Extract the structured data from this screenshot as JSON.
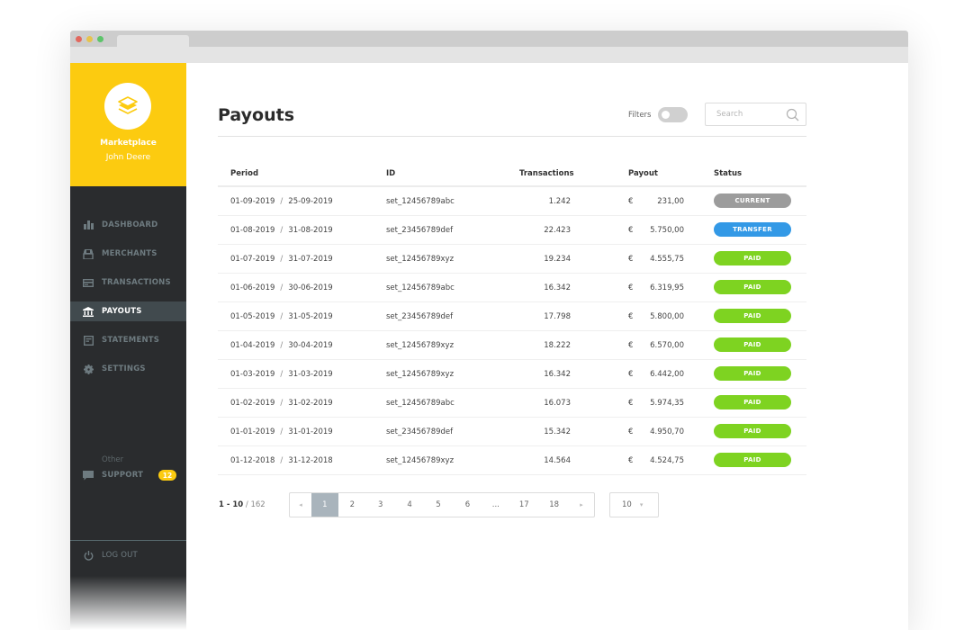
{
  "sidebar": {
    "brand": {
      "name": "Marketplace",
      "user": "John Deere",
      "logo_icon": "layers-icon"
    },
    "items": [
      {
        "label": "DASHBOARD",
        "icon": "bar-chart-icon",
        "active": false
      },
      {
        "label": "MERCHANTS",
        "icon": "store-icon",
        "active": false
      },
      {
        "label": "TRANSACTIONS",
        "icon": "credit-card-icon",
        "active": false
      },
      {
        "label": "PAYOUTS",
        "icon": "bank-icon",
        "active": true
      },
      {
        "label": "STATEMENTS",
        "icon": "document-icon",
        "active": false
      },
      {
        "label": "SETTINGS",
        "icon": "gear-icon",
        "active": false
      }
    ],
    "other_label": "Other",
    "support": {
      "label": "SUPPORT",
      "icon": "chat-icon",
      "badge": "12"
    },
    "logout": {
      "label": "LOG OUT",
      "icon": "power-icon"
    }
  },
  "header": {
    "title": "Payouts",
    "filters_label": "Filters",
    "filters_on": false,
    "search_placeholder": "Search"
  },
  "table": {
    "columns": [
      "Period",
      "ID",
      "Transactions",
      "Payout",
      "Status"
    ],
    "currency": "€",
    "rows": [
      {
        "start": "01-09-2019",
        "end": "25-09-2019",
        "id": "set_12456789abc",
        "transactions": "1.242",
        "payout": "231,00",
        "status": "CURRENT"
      },
      {
        "start": "01-08-2019",
        "end": "31-08-2019",
        "id": "set_23456789def",
        "transactions": "22.423",
        "payout": "5.750,00",
        "status": "TRANSFER"
      },
      {
        "start": "01-07-2019",
        "end": "31-07-2019",
        "id": "set_12456789xyz",
        "transactions": "19.234",
        "payout": "4.555,75",
        "status": "PAID"
      },
      {
        "start": "01-06-2019",
        "end": "30-06-2019",
        "id": "set_12456789abc",
        "transactions": "16.342",
        "payout": "6.319,95",
        "status": "PAID"
      },
      {
        "start": "01-05-2019",
        "end": "31-05-2019",
        "id": "set_23456789def",
        "transactions": "17.798",
        "payout": "5.800,00",
        "status": "PAID"
      },
      {
        "start": "01-04-2019",
        "end": "30-04-2019",
        "id": "set_12456789xyz",
        "transactions": "18.222",
        "payout": "6.570,00",
        "status": "PAID"
      },
      {
        "start": "01-03-2019",
        "end": "31-03-2019",
        "id": "set_12456789xyz",
        "transactions": "16.342",
        "payout": "6.442,00",
        "status": "PAID"
      },
      {
        "start": "01-02-2019",
        "end": "31-02-2019",
        "id": "set_12456789abc",
        "transactions": "16.073",
        "payout": "5.974,35",
        "status": "PAID"
      },
      {
        "start": "01-01-2019",
        "end": "31-01-2019",
        "id": "set_23456789def",
        "transactions": "15.342",
        "payout": "4.950,70",
        "status": "PAID"
      },
      {
        "start": "01-12-2018",
        "end": "31-12-2018",
        "id": "set_12456789xyz",
        "transactions": "14.564",
        "payout": "4.524,75",
        "status": "PAID"
      }
    ],
    "status_colors": {
      "CURRENT": "#9c9c9c",
      "TRANSFER": "#3399e6",
      "PAID": "#7ed321"
    }
  },
  "pagination": {
    "range": "1 - 10",
    "total": "/ 162",
    "prev_icon": "◂",
    "next_icon": "▸",
    "pages": [
      "1",
      "2",
      "3",
      "4",
      "5",
      "6",
      "...",
      "17",
      "18"
    ],
    "current": "1",
    "per_page": "10",
    "per_page_caret": "▾"
  },
  "colors": {
    "brand": "#fccb10",
    "sidebar": "#2a2c2e",
    "active_nav": "#414a4e"
  }
}
